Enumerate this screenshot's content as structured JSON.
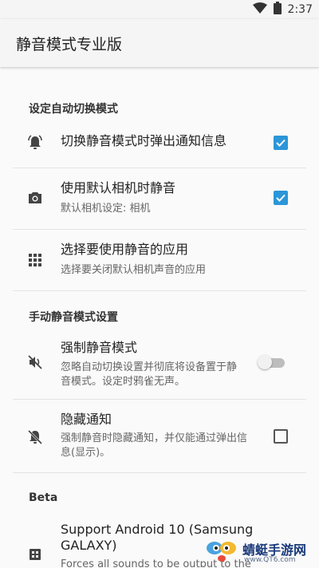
{
  "status_bar": {
    "time": "2:37"
  },
  "app_bar": {
    "title": "静音模式专业版"
  },
  "sections": [
    {
      "header": "设定自动切换模式",
      "items": [
        {
          "title": "切换静音模式时弹出通知信息",
          "summary": "",
          "control": "checkbox",
          "checked": true,
          "icon": "bell-alert-icon"
        },
        {
          "title": "使用默认相机时静音",
          "summary": "默认相机设定: 相机",
          "control": "checkbox",
          "checked": true,
          "icon": "camera-icon"
        },
        {
          "title": "选择要使用静音的应用",
          "summary": "选择要关闭默认相机声音的应用",
          "control": "none",
          "icon": "apps-grid-icon"
        }
      ]
    },
    {
      "header": "手动静音模式设置",
      "items": [
        {
          "title": "强制静音模式",
          "summary_lines": [
            "忽略自动切换设置并彻底将设备置于静",
            "音模式。设定时鸦雀无声。"
          ],
          "control": "switch",
          "checked": false,
          "icon": "volume-off-icon"
        },
        {
          "title": "隐藏通知",
          "summary_lines": [
            "强制静音时隐藏通知，并仅能通过弹出信",
            "息(显示)。"
          ],
          "control": "checkbox",
          "checked": false,
          "icon": "bell-off-icon"
        }
      ]
    },
    {
      "header": "Beta",
      "items": [
        {
          "title_lines": [
            "Support Android 10 (Samsung",
            "GALAXY)"
          ],
          "summary": "Forces all sounds to be output to the",
          "control": "none",
          "icon": "chip-icon"
        }
      ]
    }
  ],
  "watermark": {
    "text": "蜻蜓手游网",
    "url": "www.QT6.com"
  },
  "colors": {
    "accent": "#2b96d8",
    "background": "#fafafa"
  }
}
